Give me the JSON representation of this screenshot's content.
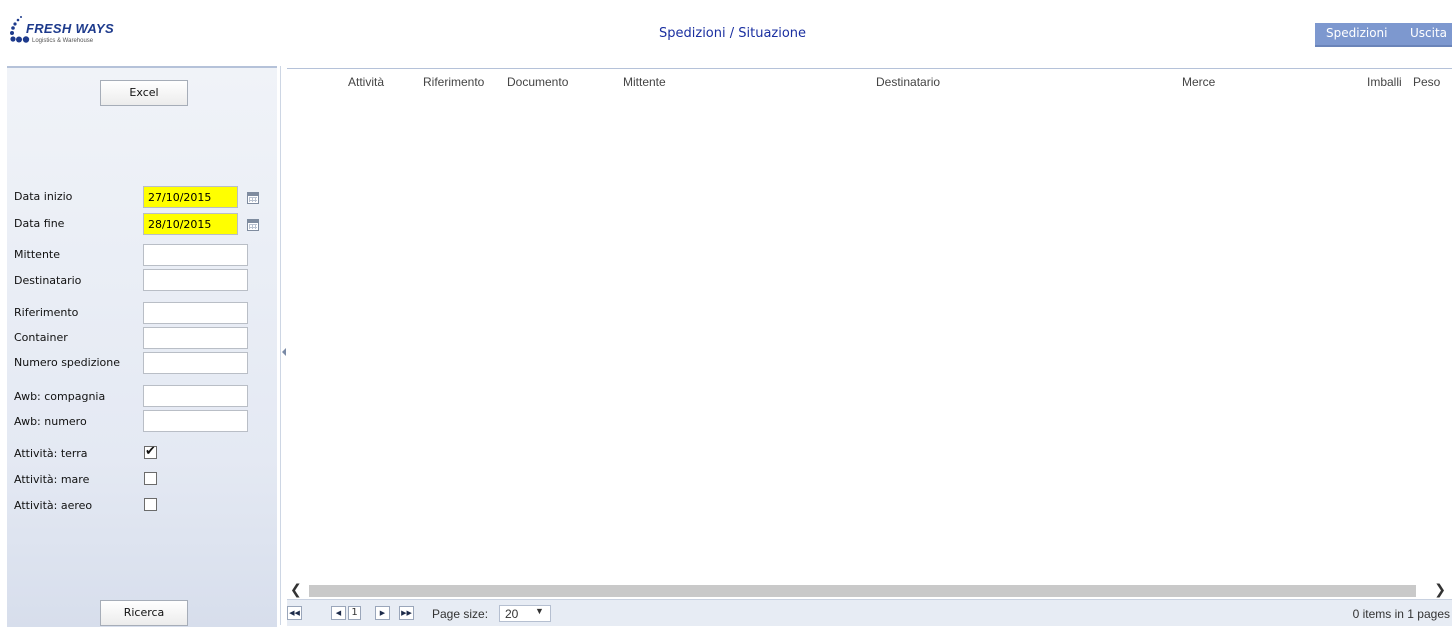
{
  "header": {
    "logo_title": "FRESH WAYS",
    "logo_subtitle": "Logistics & Warehouse",
    "page_title": "Spedizioni / Situazione",
    "nav": {
      "spedizioni": "Spedizioni",
      "uscita": "Uscita"
    }
  },
  "filters": {
    "excel_label": "Excel",
    "search_label": "Ricerca",
    "data_inizio": {
      "label": "Data inizio",
      "value": "27/10/2015"
    },
    "data_fine": {
      "label": "Data fine",
      "value": "28/10/2015"
    },
    "mittente": {
      "label": "Mittente",
      "value": ""
    },
    "destinatario": {
      "label": "Destinatario",
      "value": ""
    },
    "riferimento": {
      "label": "Riferimento",
      "value": ""
    },
    "container": {
      "label": "Container",
      "value": ""
    },
    "numero_spedizione": {
      "label": "Numero spedizione",
      "value": ""
    },
    "awb_compagnia": {
      "label": "Awb: compagnia",
      "value": ""
    },
    "awb_numero": {
      "label": "Awb: numero",
      "value": ""
    },
    "attivita_terra": {
      "label": "Attività: terra",
      "checked": true
    },
    "attivita_mare": {
      "label": "Attività: mare",
      "checked": false
    },
    "attivita_aereo": {
      "label": "Attività: aereo",
      "checked": false
    }
  },
  "grid": {
    "columns": [
      "Attività",
      "Riferimento",
      "Documento",
      "Mittente",
      "Destinatario",
      "Merce",
      "Imballi",
      "Peso"
    ],
    "rows": []
  },
  "pager": {
    "current_page": "1",
    "page_size_label": "Page size:",
    "page_size": "20",
    "info": "0 items in 1 pages"
  },
  "colors": {
    "nav_bg": "#7d98cf",
    "title_color": "#1a2fa0",
    "date_highlight": "#ffff00",
    "panel_bg": "#e4e9f3"
  }
}
